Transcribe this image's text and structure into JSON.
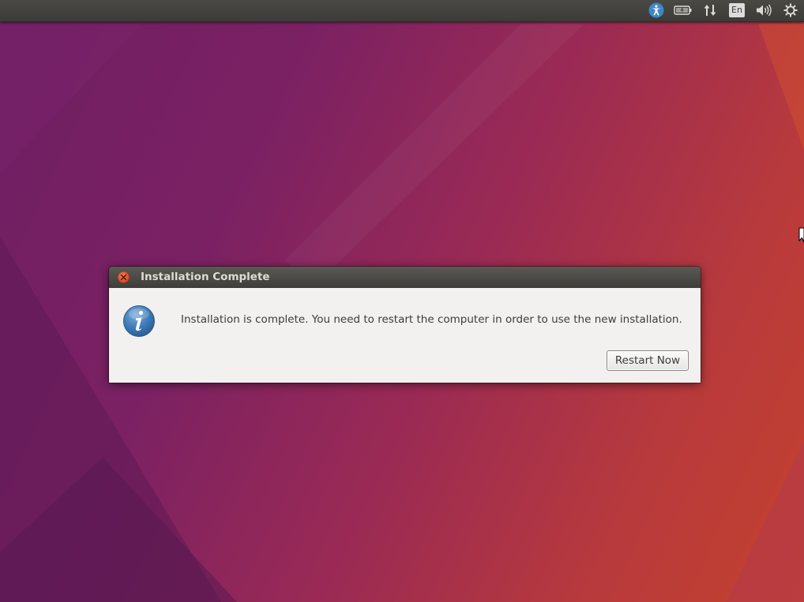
{
  "desktop": {
    "background_colors": [
      "#6e1f63",
      "#9a2a55",
      "#c4402d"
    ]
  },
  "top_panel": {
    "indicators": [
      {
        "name": "accessibility-icon",
        "color": "#3d87c7"
      },
      {
        "name": "battery-icon"
      },
      {
        "name": "network-icon"
      },
      {
        "name": "keyboard-layout",
        "label": "En"
      },
      {
        "name": "volume-icon"
      },
      {
        "name": "system-menu-gear-icon"
      }
    ]
  },
  "dialog": {
    "title": "Installation Complete",
    "close_icon": "close-icon",
    "close_color": "#df4a1e",
    "info_icon": "info-icon",
    "message": "Installation is complete. You need to restart the computer in order to use the new installation.",
    "restart_label": "Restart Now"
  }
}
